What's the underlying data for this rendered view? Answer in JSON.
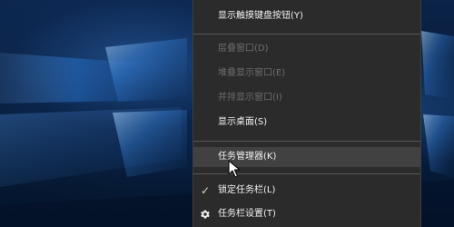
{
  "menu": {
    "items": [
      {
        "label": "显示触摸键盘按钮(Y)",
        "state": "enabled"
      },
      {
        "label": "层叠窗口(D)",
        "state": "disabled"
      },
      {
        "label": "堆叠显示窗口(E)",
        "state": "disabled"
      },
      {
        "label": "并排显示窗口(I)",
        "state": "disabled"
      },
      {
        "label": "显示桌面(S)",
        "state": "enabled"
      },
      {
        "label": "任务管理器(K)",
        "state": "highlighted"
      },
      {
        "label": "锁定任务栏(L)",
        "state": "checked"
      },
      {
        "label": "任务栏设置(T)",
        "state": "enabled",
        "icon": "gear-icon"
      }
    ],
    "check_symbol": "✓"
  },
  "colors": {
    "menu_background": "#2b2b2b",
    "menu_hover": "#414141",
    "menu_text": "#f3f3f3",
    "menu_disabled_text": "#6d6d6d",
    "separator": "#575757"
  },
  "icons": {
    "settings": "gear-icon",
    "pointer": "mouse-cursor-icon",
    "check": "checkmark-icon"
  }
}
